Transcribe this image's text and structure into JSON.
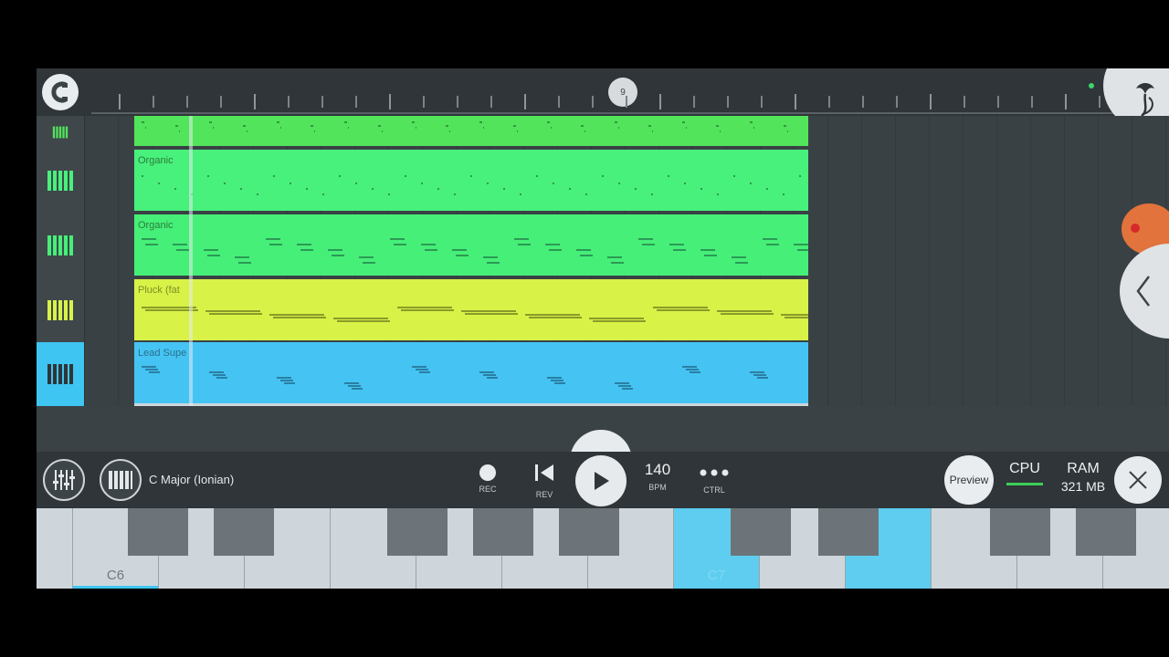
{
  "ruler": {
    "bar_marker": "9",
    "logo_icon": "magnet-snap-icon",
    "menu_icon": "fl-fruit-logo-icon"
  },
  "tracks": [
    {
      "name": "",
      "color": "#52e45a",
      "icon": "piano-keys-icon"
    },
    {
      "name": "Organic",
      "color": "#48f07c",
      "icon": "piano-keys-icon"
    },
    {
      "name": "Organic",
      "color": "#46ef78",
      "icon": "piano-keys-icon"
    },
    {
      "name": "Pluck (fat",
      "color": "#d8f247",
      "icon": "piano-keys-icon"
    },
    {
      "name": "Lead Supe",
      "color": "#45c4f3",
      "icon": "piano-keys-icon",
      "selected": true
    }
  ],
  "toolbar": {
    "mixer_icon": "mixer-sliders-icon",
    "piano_icon": "piano-keys-icon",
    "scale": "C Major (Ionian)",
    "rec_label": "REC",
    "rev_label": "REV",
    "bpm_value": "140",
    "bpm_label": "BPM",
    "ctrl_label": "CTRL",
    "preview_label": "Preview",
    "cpu_label": "CPU",
    "ram_label": "RAM",
    "ram_value": "321 MB"
  },
  "keyboard": {
    "labels": [
      "C6",
      "C7"
    ]
  },
  "colors": {
    "accent": "#3ec5f2",
    "record": "#d62a2a"
  }
}
